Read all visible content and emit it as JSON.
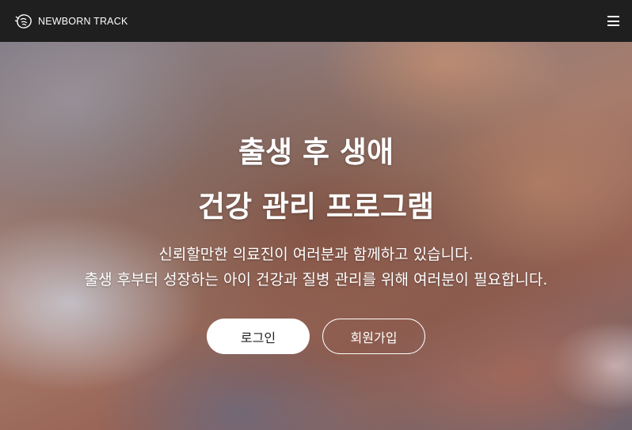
{
  "header": {
    "brand": "NEWBORN TRACK",
    "logo_icon": "baby-hand-logo-icon",
    "menu_icon": "hamburger-menu-icon"
  },
  "hero": {
    "title_line1": "출생 후 생애",
    "title_line2": "건강 관리 프로그램",
    "subtitle_line1": "신뢰할만한 의료진이 여러분과 함께하고 있습니다.",
    "subtitle_line2": "출생 후부터 성장하는 아이 건강과 질병 관리를 위해 여러분이 필요합니다.",
    "login_label": "로그인",
    "signup_label": "회원가입"
  },
  "colors": {
    "header_bg": "#1f1f1f",
    "text_light": "#ffffff",
    "login_bg": "#ffffff"
  }
}
